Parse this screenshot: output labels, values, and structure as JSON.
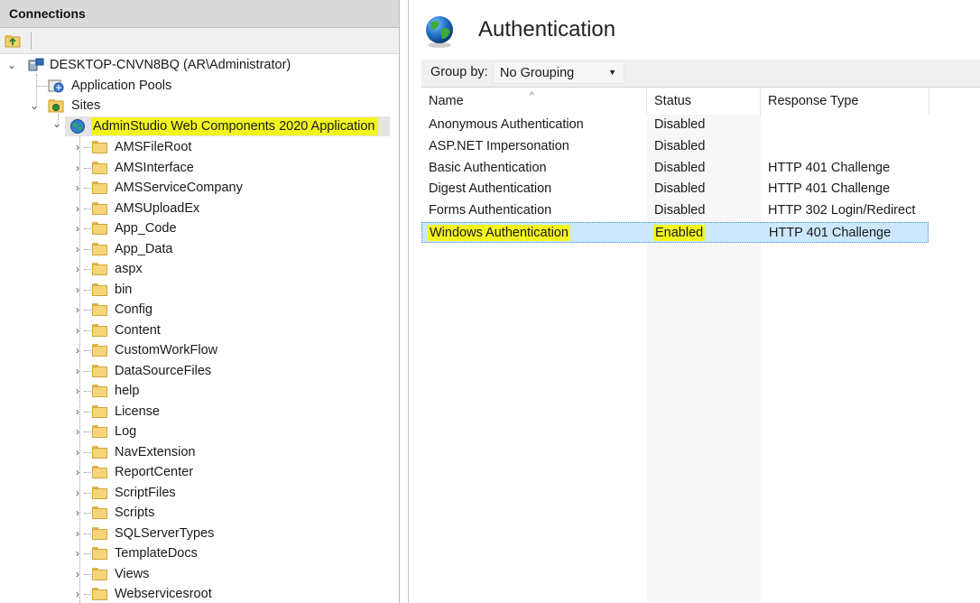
{
  "connections": {
    "title": "Connections",
    "server": "DESKTOP-CNVN8BQ (AR\\Administrator)",
    "app_pools": "Application Pools",
    "sites": "Sites",
    "site_name": "AdminStudio Web Components 2020 Application",
    "folders": [
      "AMSFileRoot",
      "AMSInterface",
      "AMSServiceCompany",
      "AMSUploadEx",
      "App_Code",
      "App_Data",
      "aspx",
      "bin",
      "Config",
      "Content",
      "CustomWorkFlow",
      "DataSourceFiles",
      "help",
      "License",
      "Log",
      "NavExtension",
      "ReportCenter",
      "ScriptFiles",
      "Scripts",
      "SQLServerTypes",
      "TemplateDocs",
      "Views",
      "Webservicesroot"
    ]
  },
  "feature": {
    "title": "Authentication",
    "group_by_label": "Group by:",
    "group_by_value": "No Grouping",
    "columns": [
      "Name",
      "Status",
      "Response Type"
    ],
    "rows": [
      {
        "name": "Anonymous Authentication",
        "status": "Disabled",
        "response": ""
      },
      {
        "name": "ASP.NET Impersonation",
        "status": "Disabled",
        "response": ""
      },
      {
        "name": "Basic Authentication",
        "status": "Disabled",
        "response": "HTTP 401 Challenge"
      },
      {
        "name": "Digest Authentication",
        "status": "Disabled",
        "response": "HTTP 401 Challenge"
      },
      {
        "name": "Forms Authentication",
        "status": "Disabled",
        "response": "HTTP 302 Login/Redirect"
      },
      {
        "name": "Windows Authentication",
        "status": "Enabled",
        "response": "HTTP 401 Challenge",
        "selected": true
      }
    ]
  },
  "colors": {
    "highlight": "#f3f61e",
    "selection": "#cce8ff",
    "header_bg": "#d9d9d9"
  }
}
